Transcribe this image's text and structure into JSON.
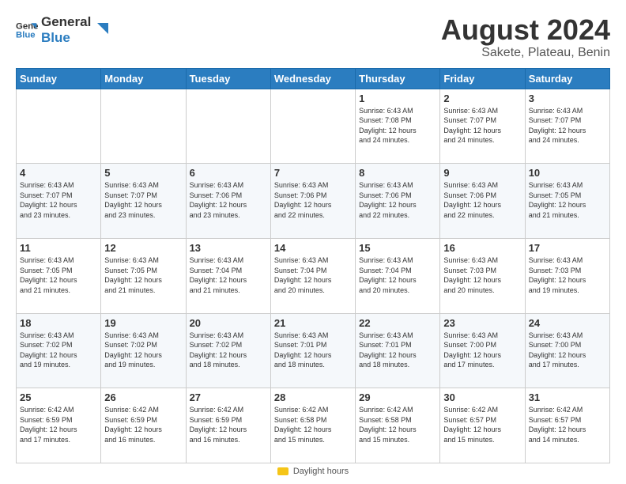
{
  "logo": {
    "line1": "General",
    "line2": "Blue"
  },
  "header": {
    "title": "August 2024",
    "subtitle": "Sakete, Plateau, Benin"
  },
  "weekdays": [
    "Sunday",
    "Monday",
    "Tuesday",
    "Wednesday",
    "Thursday",
    "Friday",
    "Saturday"
  ],
  "footer": {
    "daylight_label": "Daylight hours"
  },
  "weeks": [
    [
      {
        "day": "",
        "info": ""
      },
      {
        "day": "",
        "info": ""
      },
      {
        "day": "",
        "info": ""
      },
      {
        "day": "",
        "info": ""
      },
      {
        "day": "1",
        "info": "Sunrise: 6:43 AM\nSunset: 7:08 PM\nDaylight: 12 hours\nand 24 minutes."
      },
      {
        "day": "2",
        "info": "Sunrise: 6:43 AM\nSunset: 7:07 PM\nDaylight: 12 hours\nand 24 minutes."
      },
      {
        "day": "3",
        "info": "Sunrise: 6:43 AM\nSunset: 7:07 PM\nDaylight: 12 hours\nand 24 minutes."
      }
    ],
    [
      {
        "day": "4",
        "info": "Sunrise: 6:43 AM\nSunset: 7:07 PM\nDaylight: 12 hours\nand 23 minutes."
      },
      {
        "day": "5",
        "info": "Sunrise: 6:43 AM\nSunset: 7:07 PM\nDaylight: 12 hours\nand 23 minutes."
      },
      {
        "day": "6",
        "info": "Sunrise: 6:43 AM\nSunset: 7:06 PM\nDaylight: 12 hours\nand 23 minutes."
      },
      {
        "day": "7",
        "info": "Sunrise: 6:43 AM\nSunset: 7:06 PM\nDaylight: 12 hours\nand 22 minutes."
      },
      {
        "day": "8",
        "info": "Sunrise: 6:43 AM\nSunset: 7:06 PM\nDaylight: 12 hours\nand 22 minutes."
      },
      {
        "day": "9",
        "info": "Sunrise: 6:43 AM\nSunset: 7:06 PM\nDaylight: 12 hours\nand 22 minutes."
      },
      {
        "day": "10",
        "info": "Sunrise: 6:43 AM\nSunset: 7:05 PM\nDaylight: 12 hours\nand 21 minutes."
      }
    ],
    [
      {
        "day": "11",
        "info": "Sunrise: 6:43 AM\nSunset: 7:05 PM\nDaylight: 12 hours\nand 21 minutes."
      },
      {
        "day": "12",
        "info": "Sunrise: 6:43 AM\nSunset: 7:05 PM\nDaylight: 12 hours\nand 21 minutes."
      },
      {
        "day": "13",
        "info": "Sunrise: 6:43 AM\nSunset: 7:04 PM\nDaylight: 12 hours\nand 21 minutes."
      },
      {
        "day": "14",
        "info": "Sunrise: 6:43 AM\nSunset: 7:04 PM\nDaylight: 12 hours\nand 20 minutes."
      },
      {
        "day": "15",
        "info": "Sunrise: 6:43 AM\nSunset: 7:04 PM\nDaylight: 12 hours\nand 20 minutes."
      },
      {
        "day": "16",
        "info": "Sunrise: 6:43 AM\nSunset: 7:03 PM\nDaylight: 12 hours\nand 20 minutes."
      },
      {
        "day": "17",
        "info": "Sunrise: 6:43 AM\nSunset: 7:03 PM\nDaylight: 12 hours\nand 19 minutes."
      }
    ],
    [
      {
        "day": "18",
        "info": "Sunrise: 6:43 AM\nSunset: 7:02 PM\nDaylight: 12 hours\nand 19 minutes."
      },
      {
        "day": "19",
        "info": "Sunrise: 6:43 AM\nSunset: 7:02 PM\nDaylight: 12 hours\nand 19 minutes."
      },
      {
        "day": "20",
        "info": "Sunrise: 6:43 AM\nSunset: 7:02 PM\nDaylight: 12 hours\nand 18 minutes."
      },
      {
        "day": "21",
        "info": "Sunrise: 6:43 AM\nSunset: 7:01 PM\nDaylight: 12 hours\nand 18 minutes."
      },
      {
        "day": "22",
        "info": "Sunrise: 6:43 AM\nSunset: 7:01 PM\nDaylight: 12 hours\nand 18 minutes."
      },
      {
        "day": "23",
        "info": "Sunrise: 6:43 AM\nSunset: 7:00 PM\nDaylight: 12 hours\nand 17 minutes."
      },
      {
        "day": "24",
        "info": "Sunrise: 6:43 AM\nSunset: 7:00 PM\nDaylight: 12 hours\nand 17 minutes."
      }
    ],
    [
      {
        "day": "25",
        "info": "Sunrise: 6:42 AM\nSunset: 6:59 PM\nDaylight: 12 hours\nand 17 minutes."
      },
      {
        "day": "26",
        "info": "Sunrise: 6:42 AM\nSunset: 6:59 PM\nDaylight: 12 hours\nand 16 minutes."
      },
      {
        "day": "27",
        "info": "Sunrise: 6:42 AM\nSunset: 6:59 PM\nDaylight: 12 hours\nand 16 minutes."
      },
      {
        "day": "28",
        "info": "Sunrise: 6:42 AM\nSunset: 6:58 PM\nDaylight: 12 hours\nand 15 minutes."
      },
      {
        "day": "29",
        "info": "Sunrise: 6:42 AM\nSunset: 6:58 PM\nDaylight: 12 hours\nand 15 minutes."
      },
      {
        "day": "30",
        "info": "Sunrise: 6:42 AM\nSunset: 6:57 PM\nDaylight: 12 hours\nand 15 minutes."
      },
      {
        "day": "31",
        "info": "Sunrise: 6:42 AM\nSunset: 6:57 PM\nDaylight: 12 hours\nand 14 minutes."
      }
    ]
  ]
}
